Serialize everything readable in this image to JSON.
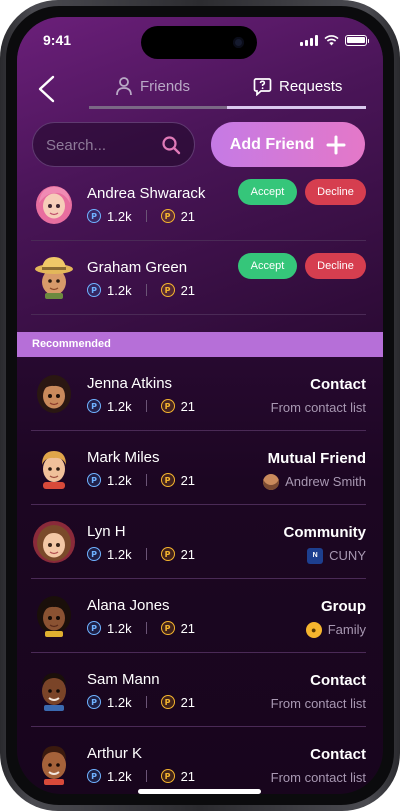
{
  "status_bar": {
    "time": "9:41"
  },
  "nav": {
    "friends_label": "Friends",
    "requests_label": "Requests",
    "active_tab": "Requests"
  },
  "search": {
    "placeholder": "Search..."
  },
  "add_friend": {
    "label": "Add Friend"
  },
  "requests": [
    {
      "name": "Andrea Shwarack",
      "points": "1.2k",
      "coins": "21",
      "accept_label": "Accept",
      "decline_label": "Decline",
      "avatar": "avatar-pink-hair"
    },
    {
      "name": "Graham Green",
      "points": "1.2k",
      "coins": "21",
      "accept_label": "Accept",
      "decline_label": "Decline",
      "avatar": "avatar-safari-hat"
    }
  ],
  "recommended": {
    "label": "Recommended",
    "items": [
      {
        "name": "Jenna Atkins",
        "points": "1.2k",
        "coins": "21",
        "source": "Contact",
        "detail": "From contact list",
        "detail_icon": ""
      },
      {
        "name": "Mark Miles",
        "points": "1.2k",
        "coins": "21",
        "source": "Mutual Friend",
        "detail": "Andrew Smith",
        "detail_icon": "friend-avatar-icon"
      },
      {
        "name": "Lyn H",
        "points": "1.2k",
        "coins": "21",
        "source": "Community",
        "detail": "CUNY",
        "detail_icon": "cuny-logo-icon"
      },
      {
        "name": "Alana Jones",
        "points": "1.2k",
        "coins": "21",
        "source": "Group",
        "detail": "Family",
        "detail_icon": "group-icon"
      },
      {
        "name": "Sam Mann",
        "points": "1.2k",
        "coins": "21",
        "source": "Contact",
        "detail": "From contact list",
        "detail_icon": ""
      },
      {
        "name": "Arthur K",
        "points": "1.2k",
        "coins": "21",
        "source": "Contact",
        "detail": "From contact list",
        "detail_icon": ""
      }
    ]
  },
  "icons": {
    "points_coin": "points-coin-icon",
    "gold_coin": "gold-coin-icon",
    "coin_glyph": "P"
  },
  "colors": {
    "accept": "#35c67a",
    "decline": "#d63e4f",
    "banner": "#b66fd8",
    "add_button": "#d77ad6",
    "background": "#2d0b37"
  }
}
